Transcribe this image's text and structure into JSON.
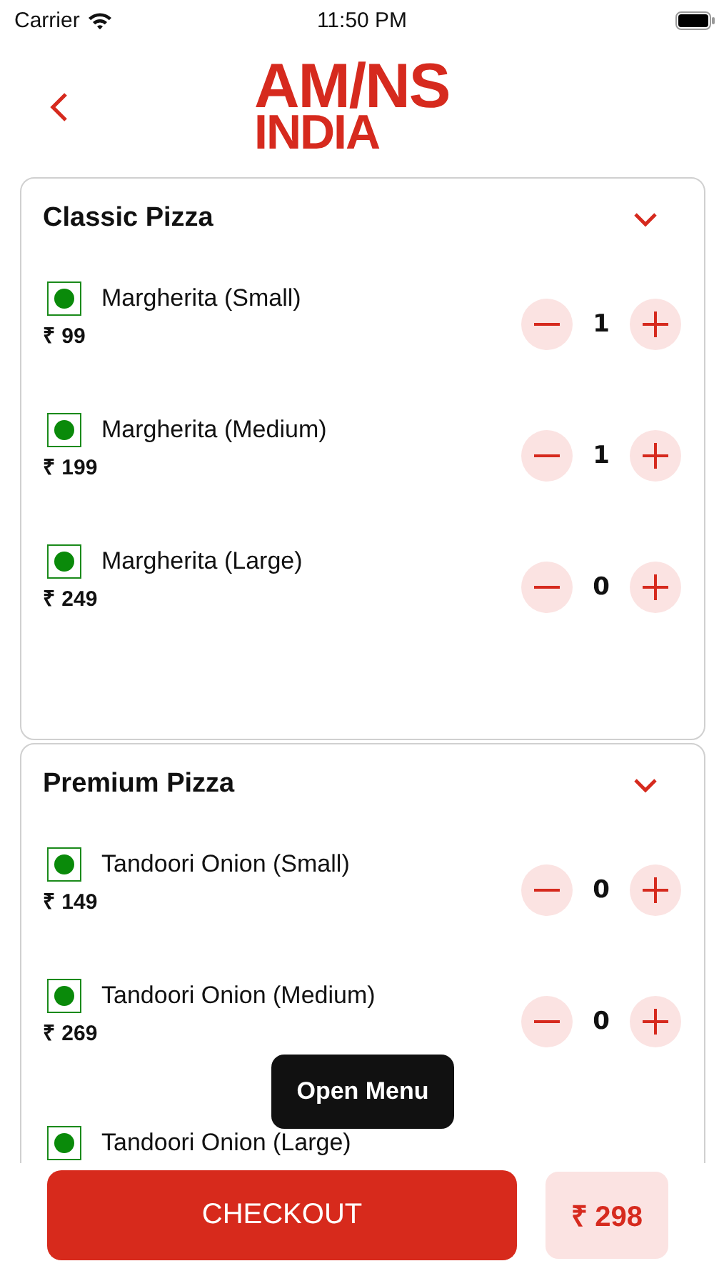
{
  "status_bar": {
    "carrier": "Carrier",
    "time": "11:50 PM"
  },
  "header": {
    "logo_line_1": "AM/NS",
    "logo_line_2": "INDIA"
  },
  "sections": [
    {
      "title": "Classic Pizza",
      "expanded": true,
      "items": [
        {
          "name": "Margherita (Small)",
          "price": "₹ 99",
          "quantity": "1",
          "veg": true
        },
        {
          "name": "Margherita (Medium)",
          "price": "₹ 199",
          "quantity": "1",
          "veg": true
        },
        {
          "name": "Margherita (Large)",
          "price": "₹ 249",
          "quantity": "0",
          "veg": true
        }
      ]
    },
    {
      "title": "Premium Pizza",
      "expanded": true,
      "items": [
        {
          "name": "Tandoori Onion (Small)",
          "price": "₹ 149",
          "quantity": "0",
          "veg": true
        },
        {
          "name": "Tandoori Onion (Medium)",
          "price": "₹ 269",
          "quantity": "0",
          "veg": true
        },
        {
          "name": "Tandoori Onion (Large)",
          "veg": true
        }
      ]
    }
  ],
  "tooltip": "Open Menu",
  "checkout": {
    "button": "CHECKOUT",
    "total": "₹ 298"
  }
}
